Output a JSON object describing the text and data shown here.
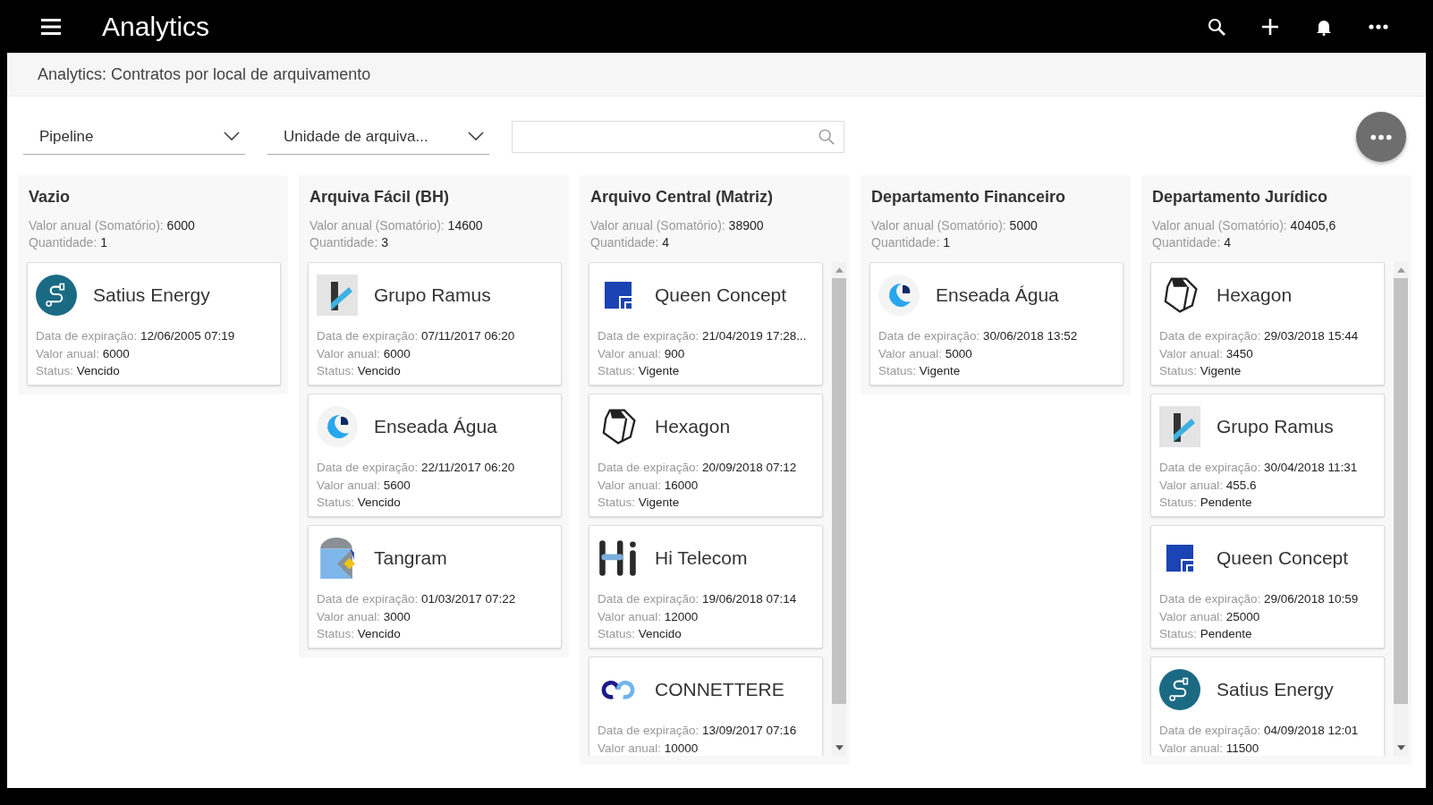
{
  "app_bar": {
    "title": "Analytics"
  },
  "page_title": "Analytics: Contratos por local de arquivamento",
  "filters": [
    {
      "value": "Pipeline"
    },
    {
      "value": "Unidade de arquiva..."
    }
  ],
  "columns": [
    {
      "title": "Vazio",
      "summary": [
        {
          "label": "Valor anual (Somatório):",
          "value": "6000"
        },
        {
          "label": "Quantidade:",
          "value": "1"
        }
      ],
      "scrollable": false,
      "cards": [
        {
          "kind": "satius",
          "name": "Satius Energy",
          "fields": [
            {
              "label": "Data de expiração:",
              "value": "12/06/2005 07:19"
            },
            {
              "label": "Valor anual:",
              "value": "6000"
            },
            {
              "label": "Status:",
              "value": "Vencido"
            }
          ]
        }
      ]
    },
    {
      "title": "Arquiva Fácil (BH)",
      "summary": [
        {
          "label": "Valor anual (Somatório):",
          "value": "14600"
        },
        {
          "label": "Quantidade:",
          "value": "3"
        }
      ],
      "scrollable": false,
      "cards": [
        {
          "kind": "ramus",
          "name": "Grupo Ramus",
          "fields": [
            {
              "label": "Data de expiração:",
              "value": "07/11/2017 06:20"
            },
            {
              "label": "Valor anual:",
              "value": "6000"
            },
            {
              "label": "Status:",
              "value": "Vencido"
            }
          ]
        },
        {
          "kind": "enseada",
          "name": "Enseada Água",
          "fields": [
            {
              "label": "Data de expiração:",
              "value": "22/11/2017 06:20"
            },
            {
              "label": "Valor anual:",
              "value": "5600"
            },
            {
              "label": "Status:",
              "value": "Vencido"
            }
          ]
        },
        {
          "kind": "tangram",
          "name": "Tangram",
          "fields": [
            {
              "label": "Data de expiração:",
              "value": "01/03/2017 07:22"
            },
            {
              "label": "Valor anual:",
              "value": "3000"
            },
            {
              "label": "Status:",
              "value": "Vencido"
            }
          ]
        }
      ]
    },
    {
      "title": "Arquivo Central (Matriz)",
      "summary": [
        {
          "label": "Valor anual (Somatório):",
          "value": "38900"
        },
        {
          "label": "Quantidade:",
          "value": "4"
        }
      ],
      "scrollable": true,
      "cards": [
        {
          "kind": "queen",
          "name": "Queen Concept",
          "fields": [
            {
              "label": "Data de expiração:",
              "value": "21/04/2019 17:28..."
            },
            {
              "label": "Valor anual:",
              "value": "900"
            },
            {
              "label": "Status:",
              "value": "Vigente"
            }
          ]
        },
        {
          "kind": "hexagon",
          "name": "Hexagon",
          "fields": [
            {
              "label": "Data de expiração:",
              "value": "20/09/2018 07:12"
            },
            {
              "label": "Valor anual:",
              "value": "16000"
            },
            {
              "label": "Status:",
              "value": "Vigente"
            }
          ]
        },
        {
          "kind": "hitelecom",
          "name": "Hi Telecom",
          "fields": [
            {
              "label": "Data de expiração:",
              "value": "19/06/2018 07:14"
            },
            {
              "label": "Valor anual:",
              "value": "12000"
            },
            {
              "label": "Status:",
              "value": "Vencido"
            }
          ]
        },
        {
          "kind": "connettere",
          "name": "CONNETTERE",
          "fields": [
            {
              "label": "Data de expiração:",
              "value": "13/09/2017 07:16"
            },
            {
              "label": "Valor anual:",
              "value": "10000"
            }
          ]
        }
      ]
    },
    {
      "title": "Departamento Financeiro",
      "summary": [
        {
          "label": "Valor anual (Somatório):",
          "value": "5000"
        },
        {
          "label": "Quantidade:",
          "value": "1"
        }
      ],
      "scrollable": false,
      "cards": [
        {
          "kind": "enseada",
          "name": "Enseada Água",
          "fields": [
            {
              "label": "Data de expiração:",
              "value": "30/06/2018 13:52"
            },
            {
              "label": "Valor anual:",
              "value": "5000"
            },
            {
              "label": "Status:",
              "value": "Vigente"
            }
          ]
        }
      ]
    },
    {
      "title": "Departamento Jurídico",
      "summary": [
        {
          "label": "Valor anual (Somatório):",
          "value": "40405,6"
        },
        {
          "label": "Quantidade:",
          "value": "4"
        }
      ],
      "scrollable": true,
      "cards": [
        {
          "kind": "hexagon",
          "name": "Hexagon",
          "fields": [
            {
              "label": "Data de expiração:",
              "value": "29/03/2018 15:44"
            },
            {
              "label": "Valor anual:",
              "value": "3450"
            },
            {
              "label": "Status:",
              "value": "Vigente"
            }
          ]
        },
        {
          "kind": "ramus",
          "name": "Grupo Ramus",
          "fields": [
            {
              "label": "Data de expiração:",
              "value": "30/04/2018 11:31"
            },
            {
              "label": "Valor anual:",
              "value": "455.6"
            },
            {
              "label": "Status:",
              "value": "Pendente"
            }
          ]
        },
        {
          "kind": "queen",
          "name": "Queen Concept",
          "fields": [
            {
              "label": "Data de expiração:",
              "value": "29/06/2018 10:59"
            },
            {
              "label": "Valor anual:",
              "value": "25000"
            },
            {
              "label": "Status:",
              "value": "Pendente"
            }
          ]
        },
        {
          "kind": "satius",
          "name": "Satius Energy",
          "fields": [
            {
              "label": "Data de expiração:",
              "value": "04/09/2018 12:01"
            },
            {
              "label": "Valor anual:",
              "value": "11500"
            }
          ]
        }
      ]
    }
  ]
}
